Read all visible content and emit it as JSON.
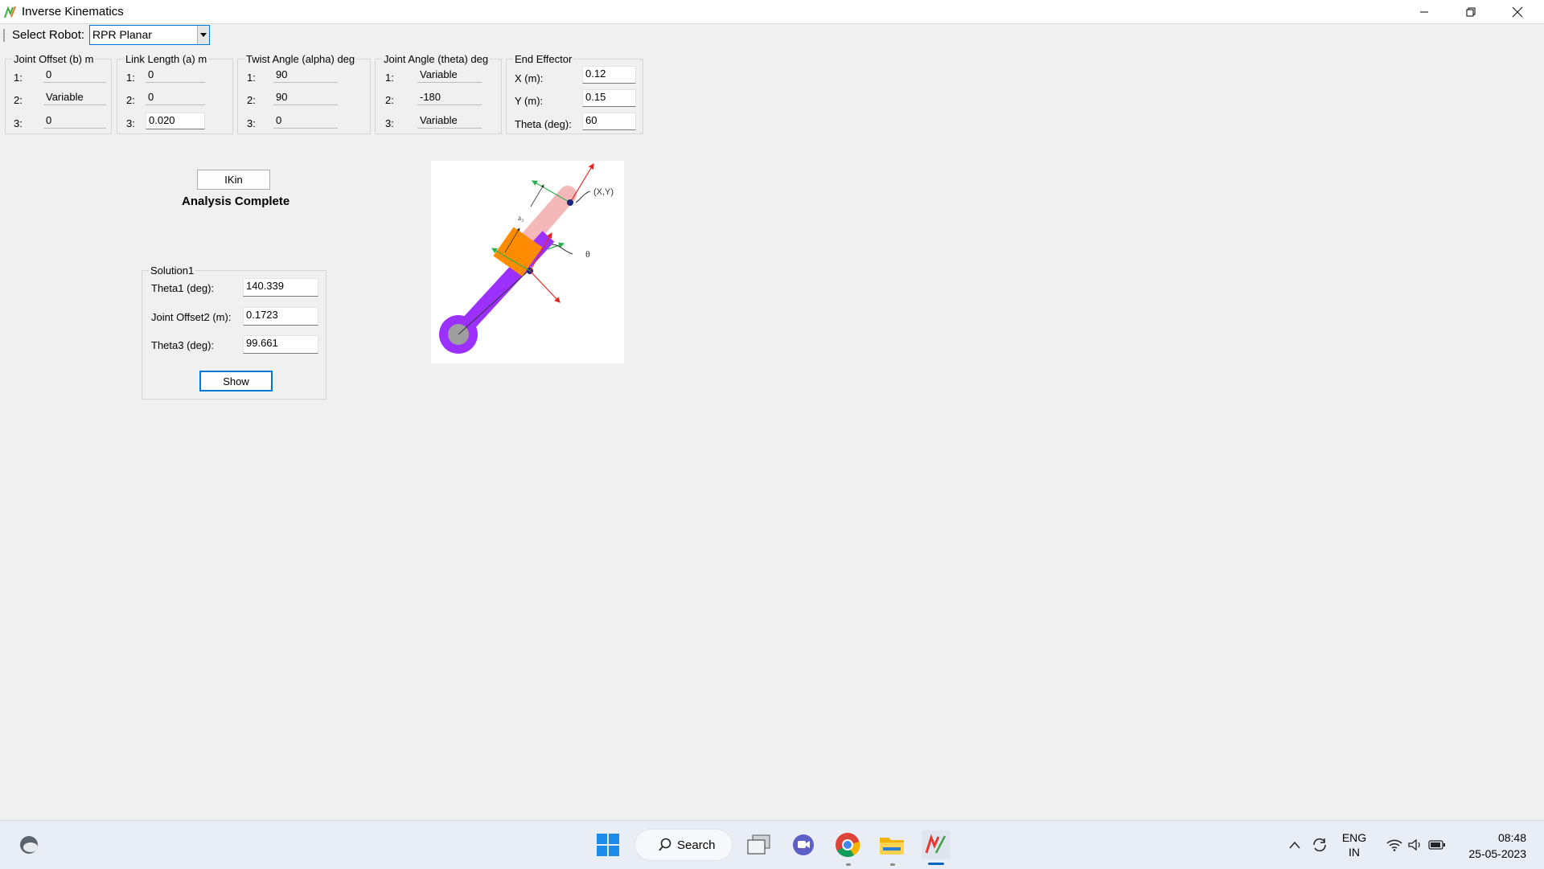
{
  "window": {
    "title": "Inverse Kinematics"
  },
  "toolbar": {
    "select_label": "Select Robot:",
    "selected_robot": "RPR Planar"
  },
  "groups": {
    "joint_offset": {
      "title": "Joint Offset (b) m",
      "labels": [
        "1:",
        "2:",
        "3:"
      ],
      "values": [
        "0",
        "Variable",
        "0"
      ]
    },
    "link_length": {
      "title": "Link Length (a) m",
      "labels": [
        "1:",
        "2:",
        "3:"
      ],
      "values": [
        "0",
        "0",
        "0.020"
      ]
    },
    "twist_angle": {
      "title": "Twist Angle (alpha) deg",
      "labels": [
        "1:",
        "2:",
        "3:"
      ],
      "values": [
        "90",
        "90",
        "0"
      ]
    },
    "joint_angle": {
      "title": "Joint Angle (theta) deg",
      "labels": [
        "1:",
        "2:",
        "3:"
      ],
      "values": [
        "Variable",
        "-180",
        "Variable"
      ]
    },
    "end_effector": {
      "title": "End Effector",
      "labels": [
        "X (m):",
        "Y (m):",
        "Theta (deg):"
      ],
      "values": [
        "0.12",
        "0.15",
        "60"
      ]
    }
  },
  "ikin": {
    "button_label": "IKin",
    "status": "Analysis Complete"
  },
  "solution": {
    "title": "Solution1",
    "labels": [
      "Theta1 (deg):",
      "Joint Offset2 (m):",
      "Theta3 (deg):"
    ],
    "values": [
      "140.339",
      "0.1723",
      "99.661"
    ],
    "show_label": "Show"
  },
  "diagram": {
    "point_label": "(X,Y)",
    "theta_label": "θ",
    "link_label": "a₃"
  },
  "taskbar": {
    "search_label": "Search",
    "language_line1": "ENG",
    "language_line2": "IN",
    "time": "08:48",
    "date": "25-05-2023"
  }
}
